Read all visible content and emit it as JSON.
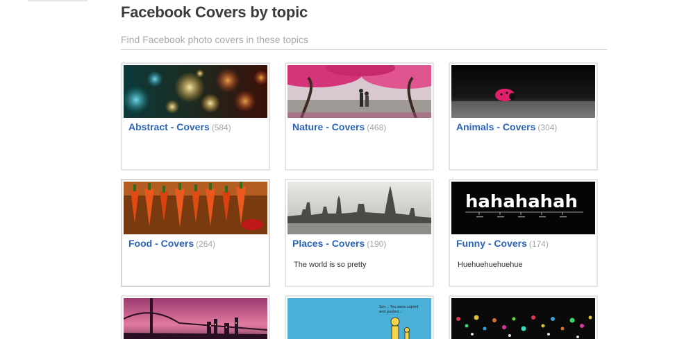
{
  "page": {
    "title": "Facebook Covers by topic",
    "subtitle": "Find Facebook photo covers in these topics"
  },
  "colors": {
    "link": "#2b63b8",
    "count": "#a5a5a5",
    "card_border": "#e4e4e4"
  },
  "cards": [
    {
      "name": "Abstract - Covers",
      "count": "(584)",
      "description": ""
    },
    {
      "name": "Nature - Covers",
      "count": "(468)",
      "description": ""
    },
    {
      "name": "Animals - Covers",
      "count": "(304)",
      "description": ""
    },
    {
      "name": "Food - Covers",
      "count": "(264)",
      "description": ""
    },
    {
      "name": "Places - Covers",
      "count": "(190)",
      "description": "The world is so pretty"
    },
    {
      "name": "Funny - Covers",
      "count": "(174)",
      "description": "Huehuehuehuehue"
    },
    {
      "name": "",
      "count": "",
      "description": ""
    },
    {
      "name": "",
      "count": "",
      "description": ""
    },
    {
      "name": "",
      "count": "",
      "description": ""
    }
  ],
  "thumb_text": {
    "funny_word": "hahahahah",
    "comic_caption_1": "Son... You were copied",
    "comic_caption_2": "and pasted..."
  }
}
